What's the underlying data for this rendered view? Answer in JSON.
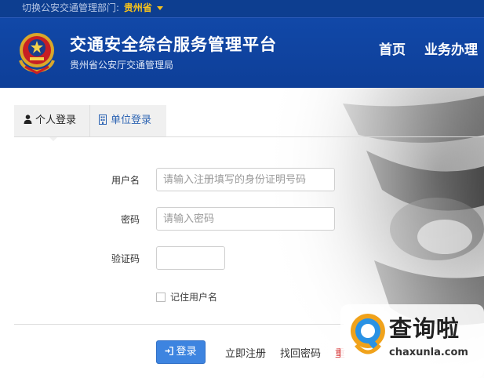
{
  "topbar": {
    "switch_label": "切换公安交通管理部门:",
    "province": "贵州省"
  },
  "header": {
    "title": "交通安全综合服务管理平台",
    "subtitle": "贵州省公安厅交通管理局",
    "nav": [
      {
        "label": "首页"
      },
      {
        "label": "业务办理"
      }
    ]
  },
  "tabs": [
    {
      "label": "个人登录",
      "icon": "user-icon",
      "active": true
    },
    {
      "label": "单位登录",
      "icon": "building-icon",
      "active": false
    }
  ],
  "form": {
    "username_label": "用户名",
    "username_placeholder": "请输入注册填写的身份证明号码",
    "password_label": "密码",
    "password_placeholder": "请输入密码",
    "captcha_label": "验证码",
    "remember_label": "记住用户名",
    "login_label": "登录",
    "login_icon": "sign-in-icon",
    "register_link": "立即注册",
    "forgot_link": "找回密码",
    "reset_link": "重"
  },
  "watermark": {
    "cn": "查询啦",
    "en": "chaxunla.com"
  },
  "colors": {
    "header_bg": "#1148a8",
    "topbar_bg": "#0d3e90",
    "province": "#f6c21c",
    "login_button": "#3d84e0",
    "tab_inactive_text": "#2d64b3"
  }
}
